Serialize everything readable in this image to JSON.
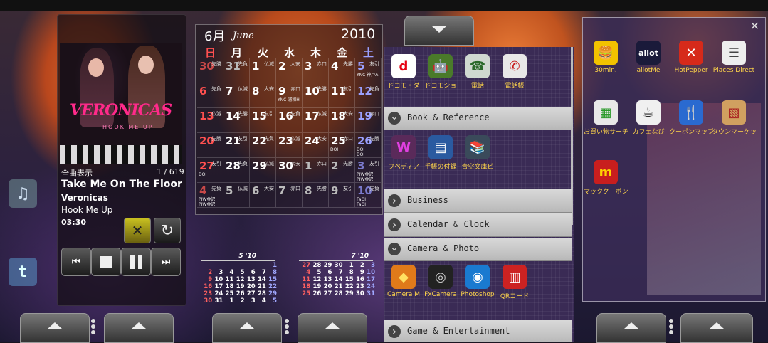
{
  "music": {
    "list_label": "全曲表示",
    "track_count": "1 / 619",
    "title": "Take Me On The Floor",
    "artist": "Veronicas",
    "album": "Hook Me Up",
    "time": "03:30",
    "cover_band": "VERONICAS",
    "cover_sub": "HOOK ME UP"
  },
  "calendar": {
    "month": "6月",
    "month_en": "June",
    "year": "2010",
    "weekdays": [
      "日",
      "月",
      "火",
      "水",
      "木",
      "金",
      "土"
    ],
    "rows": [
      [
        {
          "d": "30",
          "r": "先勝"
        },
        {
          "d": "31",
          "r": "先負"
        },
        {
          "d": "1",
          "r": "仏滅"
        },
        {
          "d": "2",
          "r": "大安"
        },
        {
          "d": "3",
          "r": "赤口"
        },
        {
          "d": "4",
          "r": "先勝"
        },
        {
          "d": "5",
          "r": "友引",
          "n": "YNC 神戸A"
        }
      ],
      [
        {
          "d": "6",
          "r": "先負"
        },
        {
          "d": "7",
          "r": "仏滅"
        },
        {
          "d": "8",
          "r": "大安"
        },
        {
          "d": "9",
          "r": "赤口",
          "n": "YNC 浦和H"
        },
        {
          "d": "10",
          "r": "先勝"
        },
        {
          "d": "11",
          "r": "友引"
        },
        {
          "d": "12",
          "r": "先負"
        }
      ],
      [
        {
          "d": "13",
          "r": "仏滅"
        },
        {
          "d": "14",
          "r": "先勝"
        },
        {
          "d": "15",
          "r": "友引"
        },
        {
          "d": "16",
          "r": "先負"
        },
        {
          "d": "17",
          "r": "仏滅"
        },
        {
          "d": "18",
          "r": "大安"
        },
        {
          "d": "19",
          "r": "赤口"
        }
      ],
      [
        {
          "d": "20",
          "r": "先勝"
        },
        {
          "d": "21",
          "r": "友引"
        },
        {
          "d": "22",
          "r": "先負"
        },
        {
          "d": "23",
          "r": "仏滅"
        },
        {
          "d": "24",
          "r": "大安"
        },
        {
          "d": "25",
          "r": "赤口",
          "n": "DOI"
        },
        {
          "d": "26",
          "r": "先勝",
          "n": "DOI\nDOI"
        }
      ],
      [
        {
          "d": "27",
          "r": "友引",
          "n": "DOI"
        },
        {
          "d": "28",
          "r": "先負"
        },
        {
          "d": "29",
          "r": "仏滅"
        },
        {
          "d": "30",
          "r": "大安"
        },
        {
          "d": "1",
          "r": "赤口"
        },
        {
          "d": "2",
          "r": "先勝"
        },
        {
          "d": "3",
          "r": "友引",
          "n": "PIW金沢\nPIW金沢"
        }
      ],
      [
        {
          "d": "4",
          "r": "先負",
          "n": "PIW金沢\nPIW金沢"
        },
        {
          "d": "5",
          "r": "仏滅"
        },
        {
          "d": "6",
          "r": "大安"
        },
        {
          "d": "7",
          "r": "赤口"
        },
        {
          "d": "8",
          "r": "先勝"
        },
        {
          "d": "9",
          "r": "友引"
        },
        {
          "d": "10",
          "r": "先負",
          "n": "FaOI\nFaOI"
        }
      ]
    ],
    "mini_may": {
      "label": "5 '10",
      "weeks": [
        [
          "",
          "",
          "",
          "",
          "",
          "",
          "1"
        ],
        [
          "2",
          "3",
          "4",
          "5",
          "6",
          "7",
          "8"
        ],
        [
          "9",
          "10",
          "11",
          "12",
          "13",
          "14",
          "15"
        ],
        [
          "16",
          "17",
          "18",
          "19",
          "20",
          "21",
          "22"
        ],
        [
          "23",
          "24",
          "25",
          "26",
          "27",
          "28",
          "29"
        ],
        [
          "30",
          "31",
          "1",
          "2",
          "3",
          "4",
          "5"
        ]
      ]
    },
    "mini_jul": {
      "label": "7 '10",
      "weeks": [
        [
          "27",
          "28",
          "29",
          "30",
          "1",
          "2",
          "3"
        ],
        [
          "4",
          "5",
          "6",
          "7",
          "8",
          "9",
          "10"
        ],
        [
          "11",
          "12",
          "13",
          "14",
          "15",
          "16",
          "17"
        ],
        [
          "18",
          "19",
          "20",
          "21",
          "22",
          "23",
          "24"
        ],
        [
          "25",
          "26",
          "27",
          "28",
          "29",
          "30",
          "31"
        ]
      ]
    }
  },
  "drawer": {
    "top_apps": [
      {
        "label": "ドコモ・ダ",
        "icon": "docomo-d-icon",
        "glyph": "d",
        "bg": "#ffffff",
        "fg": "#e60012"
      },
      {
        "label": "ドコモショ",
        "icon": "android-shop-icon",
        "glyph": "🤖",
        "bg": "#4a7a2a",
        "fg": "#a4c639"
      },
      {
        "label": "電話",
        "icon": "phone-keypad-icon",
        "glyph": "☎",
        "bg": "#cfd8d0",
        "fg": "#2a6a2a"
      },
      {
        "label": "電話帳",
        "icon": "contacts-icon",
        "glyph": "✆",
        "bg": "#e8e8e8",
        "fg": "#c81e1e"
      }
    ],
    "categories": [
      "Book & Reference",
      "Business",
      "Calendar & Clock",
      "Camera & Photo",
      "Game & Entertainment"
    ],
    "book_apps": [
      {
        "label": "ワペディア",
        "icon": "wapedia-icon",
        "glyph": "W",
        "bg": "#5a2a5a",
        "fg": "#e040e0"
      },
      {
        "label": "手帳の付録",
        "icon": "notebook-icon",
        "glyph": "▤",
        "bg": "#2a5aa0",
        "fg": "#ffffff"
      },
      {
        "label": "青空文庫ビ",
        "icon": "books-icon",
        "glyph": "📚",
        "bg": "#3a4a5a",
        "fg": "#ffffff"
      }
    ],
    "camera_apps": [
      {
        "label": "Camera M",
        "icon": "camera-magic-icon",
        "glyph": "◆",
        "bg": "#e07a1a",
        "fg": "#ffe060"
      },
      {
        "label": "FxCamera",
        "icon": "fxcamera-lens-icon",
        "glyph": "◎",
        "bg": "#222222",
        "fg": "#cccccc"
      },
      {
        "label": "Photoshop",
        "icon": "photoshop-icon",
        "glyph": "◉",
        "bg": "#1a7ad0",
        "fg": "#ffffff"
      },
      {
        "label": "QRコード",
        "icon": "qr-barcode-icon",
        "glyph": "▥",
        "bg": "#cc2222",
        "fg": "#ffffff"
      }
    ]
  },
  "folder": {
    "apps": [
      {
        "label": "30min.",
        "icon": "burger-icon",
        "glyph": "🍔",
        "bg": "#f2c200",
        "fg": "#8a3a00"
      },
      {
        "label": "allotMe",
        "icon": "allotme-icon",
        "glyph": "allot",
        "bg": "#1a1a3a",
        "fg": "#ffffff"
      },
      {
        "label": "HotPepper",
        "icon": "hotpepper-icon",
        "glyph": "✕",
        "bg": "#d62a1a",
        "fg": "#ffffff"
      },
      {
        "label": "Places Direct",
        "icon": "places-directory-icon",
        "glyph": "☰",
        "bg": "#eeeeee",
        "fg": "#444444"
      },
      {
        "label": "お買い物サーチ",
        "icon": "shopping-search-icon",
        "glyph": "▦",
        "bg": "#e8e8e8",
        "fg": "#2a9a2a"
      },
      {
        "label": "カフェなび",
        "icon": "cafe-navi-icon",
        "glyph": "☕",
        "bg": "#f0f0f0",
        "fg": "#2a2a2a"
      },
      {
        "label": "クーポンマップ",
        "icon": "coupon-map-icon",
        "glyph": "🍴",
        "bg": "#2a6ad0",
        "fg": "#ffffff"
      },
      {
        "label": "タウンマーケット",
        "icon": "town-market-icon",
        "glyph": "▧",
        "bg": "#d0a060",
        "fg": "#aa2222"
      },
      {
        "label": "マッククーポン",
        "icon": "mac-coupon-icon",
        "glyph": "m",
        "bg": "#c81e1e",
        "fg": "#ffd400"
      }
    ]
  }
}
